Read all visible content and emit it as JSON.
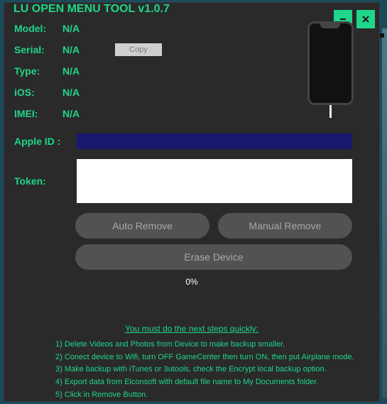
{
  "window": {
    "title": "LU OPEN MENU TOOL v1.0.7"
  },
  "info": {
    "model_label": "Model:",
    "model_val": "N/A",
    "serial_label": "Serial:",
    "serial_val": "N/A",
    "type_label": "Type:",
    "type_val": "N/A",
    "ios_label": "iOS:",
    "ios_val": "N/A",
    "imei_label": "IMEI:",
    "imei_val": "N/A",
    "copy_label": "Copy"
  },
  "form": {
    "appleid_label": "Apple ID :",
    "appleid_value": "",
    "token_label": "Token:",
    "token_value": ""
  },
  "buttons": {
    "auto_remove": "Auto Remove",
    "manual_remove": "Manual Remove",
    "erase": "Erase Device"
  },
  "progress": {
    "text": "0%"
  },
  "instructions": {
    "heading": "You must do the next steps quickly:",
    "line1": "1) Delete Videos and Photos from Device to make backup smaller.",
    "line2": "2) Conect device to Wifi, turn OFF GameCenter then turn ON, then put Airplane mode.",
    "line3": "3) Make backup with iTunes or 3utools, check the Encrypt local backup option.",
    "line4": "4) Export data from Elconsoft with default file name to My Documents folder.",
    "line5": "5) Click in Remove Button."
  }
}
